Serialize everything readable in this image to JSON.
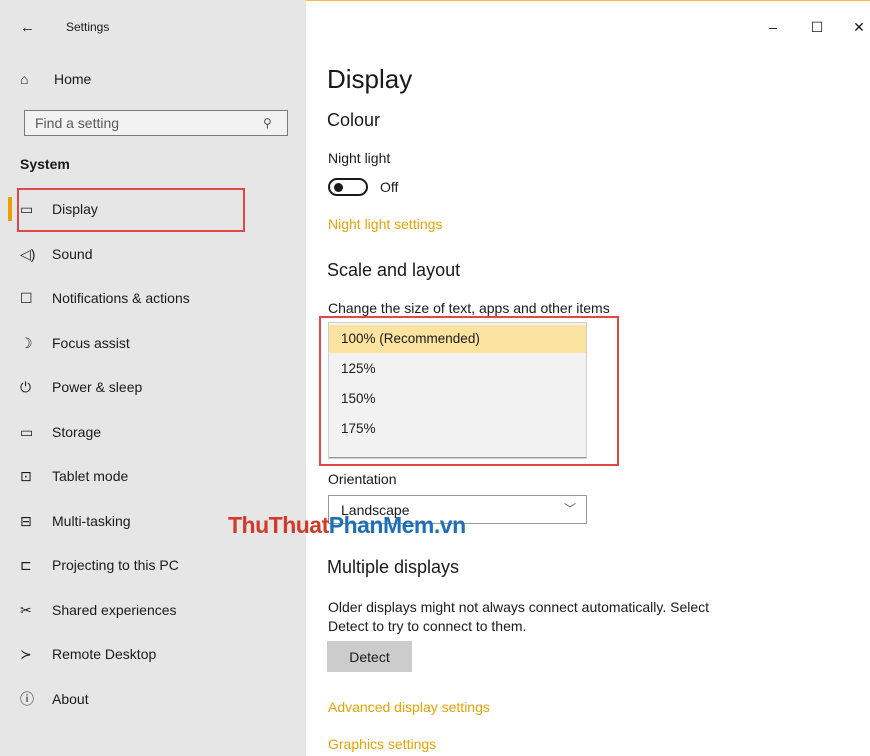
{
  "window": {
    "title": "Settings",
    "back_icon": "←",
    "minimize": "–",
    "maximize": "☐",
    "close": "✕"
  },
  "sidebar": {
    "home": {
      "label": "Home",
      "icon": "⌂"
    },
    "search_placeholder": "Find a setting",
    "section": "System",
    "items": [
      {
        "label": "Display",
        "icon": "▭"
      },
      {
        "label": "Sound",
        "icon": "◁)"
      },
      {
        "label": "Notifications & actions",
        "icon": "☐"
      },
      {
        "label": "Focus assist",
        "icon": "☽"
      },
      {
        "label": "Power & sleep",
        "icon": "⏻"
      },
      {
        "label": "Storage",
        "icon": "▭"
      },
      {
        "label": "Tablet mode",
        "icon": "⊡"
      },
      {
        "label": "Multi-tasking",
        "icon": "⊟"
      },
      {
        "label": "Projecting to this PC",
        "icon": "⊏"
      },
      {
        "label": "Shared experiences",
        "icon": "✂"
      },
      {
        "label": "Remote Desktop",
        "icon": "≻"
      },
      {
        "label": "About",
        "icon": "ⓘ"
      }
    ],
    "accent": "#e8a200"
  },
  "main": {
    "title": "Display",
    "colour": {
      "heading": "Colour",
      "night_light_label": "Night light",
      "toggle_state": "Off",
      "settings_link": "Night light settings"
    },
    "scale": {
      "heading": "Scale and layout",
      "change_size_label": "Change the size of text, apps and other items",
      "options": [
        "100% (Recommended)",
        "125%",
        "150%",
        "175%"
      ],
      "selected_index": 0,
      "orientation_label": "Orientation",
      "orientation_value": "Landscape"
    },
    "multiple": {
      "heading": "Multiple displays",
      "description_line1": "Older displays might not always connect automatically. Select",
      "description_line2": "Detect to try to connect to them.",
      "detect_button": "Detect",
      "advanced_link": "Advanced display settings",
      "graphics_link": "Graphics settings"
    }
  },
  "watermark": {
    "part1": "ThuThuat",
    "part2": "PhanMem.vn"
  },
  "colors": {
    "link": "#e8a200",
    "highlight": "#fde3a0",
    "annotation": "#e04848"
  }
}
